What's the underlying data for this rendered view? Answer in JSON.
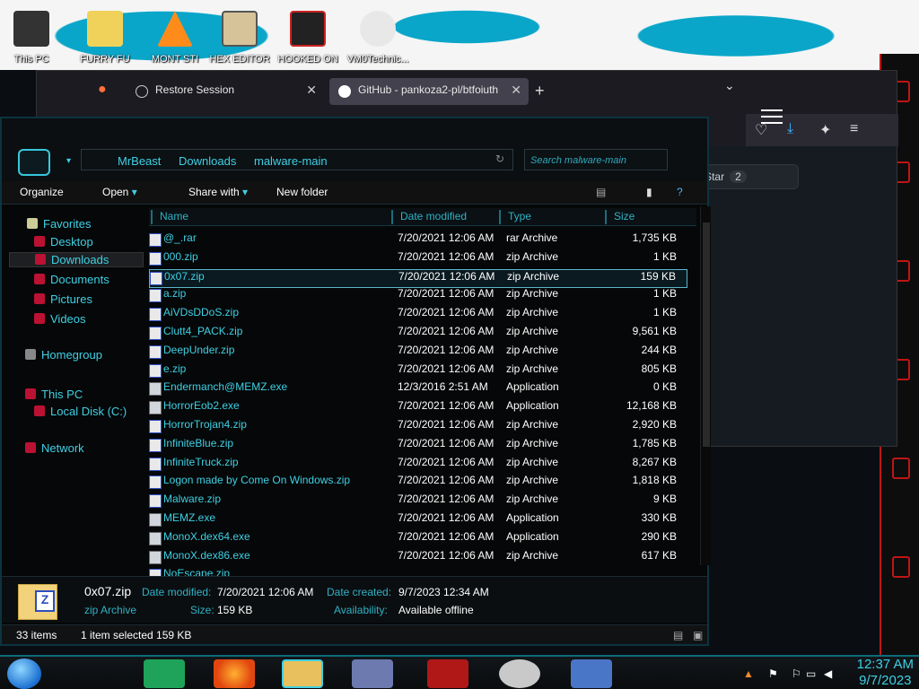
{
  "desktop": {
    "icons": [
      {
        "label": "This PC"
      },
      {
        "label": "FURRY FU"
      },
      {
        "label": "MONT STI"
      },
      {
        "label": "HEX EDITOR"
      },
      {
        "label": "HOOKED ON"
      },
      {
        "label": "VM0Technic..."
      }
    ]
  },
  "browser": {
    "tabs": [
      {
        "label": "Restore Session"
      },
      {
        "label": "GitHub - pankoza2-pl/btfoiuth"
      }
    ],
    "star_label": "Star",
    "star_count": "2"
  },
  "explorer": {
    "breadcrumb": [
      "MrBeast",
      "Downloads",
      "malware-main"
    ],
    "search_placeholder": "Search malware-main",
    "commands": {
      "organize": "Organize",
      "open": "Open",
      "share": "Share with",
      "new_folder": "New folder"
    },
    "nav": {
      "favorites": "Favorites",
      "desktop": "Desktop",
      "downloads": "Downloads",
      "documents": "Documents",
      "pictures": "Pictures",
      "videos": "Videos",
      "homegroup": "Homegroup",
      "this_pc": "This PC",
      "local_disk": "Local Disk (C:)",
      "network": "Network"
    },
    "columns": {
      "name": "Name",
      "date": "Date modified",
      "type": "Type",
      "size": "Size"
    },
    "files": [
      {
        "name": "@_.rar",
        "date": "7/20/2021 12:06 AM",
        "type": "rar Archive",
        "size": "1,735 KB",
        "icon": "zip-icon"
      },
      {
        "name": "000.zip",
        "date": "7/20/2021 12:06 AM",
        "type": "zip Archive",
        "size": "1 KB",
        "icon": "zip-icon"
      },
      {
        "name": "0x07.zip",
        "date": "7/20/2021 12:06 AM",
        "type": "zip Archive",
        "size": "159 KB",
        "icon": "zip-icon"
      },
      {
        "name": "a.zip",
        "date": "7/20/2021 12:06 AM",
        "type": "zip Archive",
        "size": "1 KB",
        "icon": "zip-icon"
      },
      {
        "name": "AiVDsDDoS.zip",
        "date": "7/20/2021 12:06 AM",
        "type": "zip Archive",
        "size": "1 KB",
        "icon": "zip-icon"
      },
      {
        "name": "Clutt4_PACK.zip",
        "date": "7/20/2021 12:06 AM",
        "type": "zip Archive",
        "size": "9,561 KB",
        "icon": "zip-icon"
      },
      {
        "name": "DeepUnder.zip",
        "date": "7/20/2021 12:06 AM",
        "type": "zip Archive",
        "size": "244 KB",
        "icon": "zip-icon"
      },
      {
        "name": "e.zip",
        "date": "7/20/2021 12:06 AM",
        "type": "zip Archive",
        "size": "805 KB",
        "icon": "zip-icon"
      },
      {
        "name": "Endermanch@MEMZ.exe",
        "date": "12/3/2016 2:51 AM",
        "type": "Application",
        "size": "0 KB",
        "icon": "app-icon"
      },
      {
        "name": "HorrorEob2.exe",
        "date": "7/20/2021 12:06 AM",
        "type": "Application",
        "size": "12,168 KB",
        "icon": "app-icon"
      },
      {
        "name": "HorrorTrojan4.zip",
        "date": "7/20/2021 12:06 AM",
        "type": "zip Archive",
        "size": "2,920 KB",
        "icon": "zip-icon"
      },
      {
        "name": "InfiniteBlue.zip",
        "date": "7/20/2021 12:06 AM",
        "type": "zip Archive",
        "size": "1,785 KB",
        "icon": "zip-icon"
      },
      {
        "name": "InfiniteTruck.zip",
        "date": "7/20/2021 12:06 AM",
        "type": "zip Archive",
        "size": "8,267 KB",
        "icon": "zip-icon"
      },
      {
        "name": "Logon made by Come On Windows.zip",
        "date": "7/20/2021 12:06 AM",
        "type": "zip Archive",
        "size": "1,818 KB",
        "icon": "zip-icon"
      },
      {
        "name": "Malware.zip",
        "date": "7/20/2021 12:06 AM",
        "type": "zip Archive",
        "size": "9 KB",
        "icon": "zip-icon"
      },
      {
        "name": "MEMZ.exe",
        "date": "7/20/2021 12:06 AM",
        "type": "Application",
        "size": "330 KB",
        "icon": "app-icon"
      },
      {
        "name": "MonoX.dex64.exe",
        "date": "7/20/2021 12:06 AM",
        "type": "Application",
        "size": "290 KB",
        "icon": "app-icon"
      },
      {
        "name": "MonoX.dex86.exe",
        "date": "7/20/2021 12:06 AM",
        "type": "zip Archive",
        "size": "617 KB",
        "icon": "app-icon"
      },
      {
        "name": "NoEscape.zip",
        "date": "",
        "type": "",
        "size": "",
        "icon": "zip-icon"
      }
    ],
    "details": {
      "name": "0x07.zip",
      "type": "zip Archive",
      "modified_label": "Date modified:",
      "modified_value": "7/20/2021 12:06 AM",
      "size_label": "Size:",
      "size_value": "159 KB",
      "created_label": "Date created:",
      "created_value": "9/7/2023 12:34 AM",
      "avail_label": "Availability:",
      "avail_value": "Available offline"
    },
    "status": {
      "count": "33 items",
      "selected": "1 item selected  159 KB"
    }
  },
  "taskbar": {
    "time": "12:37 AM",
    "date": "9/7/2023"
  },
  "colors": {
    "accent": "#3fd0e4",
    "frame": "#c01515",
    "bg": "#050708"
  }
}
